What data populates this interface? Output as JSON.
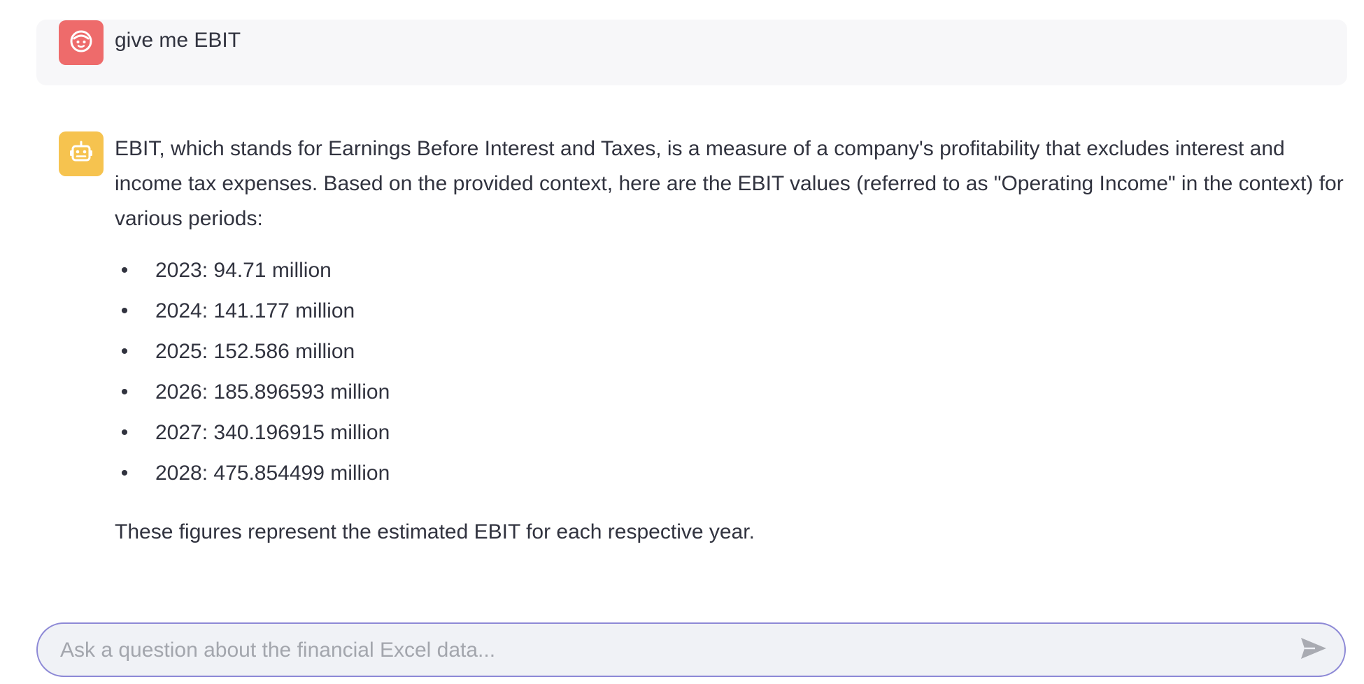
{
  "user_message": {
    "avatar_icon": "user-face-icon",
    "avatar_color": "#ee6b6b",
    "text": "give me EBIT"
  },
  "assistant_message": {
    "avatar_icon": "robot-icon",
    "avatar_color": "#f6c34f",
    "intro": "EBIT, which stands for Earnings Before Interest and Taxes, is a measure of a company's profitability that excludes interest and income tax expenses. Based on the provided context, here are the EBIT values (referred to as \"Operating Income\" in the context) for various periods:",
    "items": [
      {
        "text": "2023: 94.71 million"
      },
      {
        "text": "2024: 141.177 million"
      },
      {
        "text": "2025: 152.586 million"
      },
      {
        "text": "2026: 185.896593 million"
      },
      {
        "text": "2027: 340.196915 million"
      },
      {
        "text": "2028: 475.854499 million"
      }
    ],
    "closing": "These figures represent the estimated EBIT for each respective year."
  },
  "chat_input": {
    "placeholder": "Ask a question about the financial Excel data...",
    "value": "",
    "send_icon": "send-icon",
    "border_color": "#8d89d6"
  }
}
